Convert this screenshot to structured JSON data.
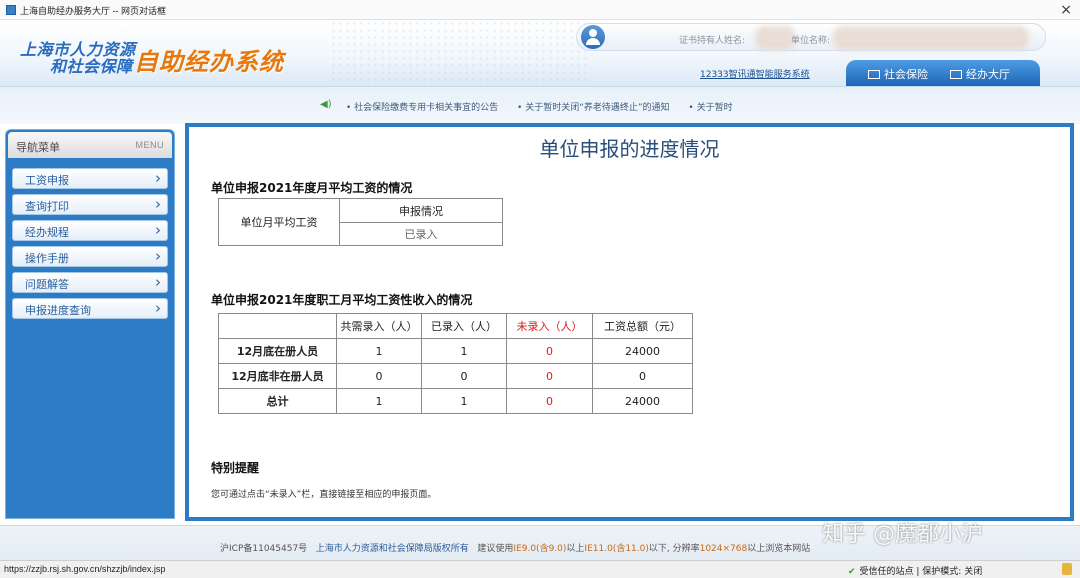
{
  "window": {
    "title": "上海自助经办服务大厅 -- 网页对话框",
    "close_glyph": "×"
  },
  "header": {
    "logo_line1": "上海市人力资源",
    "logo_line2": "和社会保障",
    "logo_system": "自助经办系统",
    "holder_label": "证书持有人姓名:",
    "unit_label": "单位名称:",
    "service_link": "12333智讯通智能服务系统",
    "tabs": [
      {
        "label": "社会保险"
      },
      {
        "label": "经办大厅"
      }
    ]
  },
  "news": {
    "items": [
      "• 社会保险缴费专用卡相关事宜的公告",
      "• 关于暂时关闭“养老待遇终止”的通知",
      "• 关于暂时"
    ]
  },
  "sidebar": {
    "title": "导航菜单",
    "menu_label": "MENU",
    "items": [
      {
        "label": "工资申报"
      },
      {
        "label": "查询打印"
      },
      {
        "label": "经办规程"
      },
      {
        "label": "操作手册"
      },
      {
        "label": "问题解答"
      },
      {
        "label": "申报进度查询"
      }
    ]
  },
  "main": {
    "title": "单位申报的进度情况",
    "section1": {
      "title": "单位申报2021年度月平均工资的情况",
      "row_header": "单位月平均工资",
      "col_header": "申报情况",
      "status": "已录入"
    },
    "section2": {
      "title": "单位申报2021年度职工月平均工资性收入的情况",
      "headers": [
        "",
        "共需录入（人）",
        "已录入（人）",
        "未录入（人）",
        "工资总额（元）"
      ],
      "rows": [
        {
          "label": "12月底在册人员",
          "values": [
            "1",
            "1",
            "0",
            "24000"
          ]
        },
        {
          "label": "12月底非在册人员",
          "values": [
            "0",
            "0",
            "0",
            "0"
          ]
        },
        {
          "label": "总计",
          "values": [
            "1",
            "1",
            "0",
            "24000"
          ]
        }
      ]
    },
    "notice": {
      "title": "特别提醒",
      "text": "您可通过点击“未录入”栏，直接链接至相应的申报页面。"
    }
  },
  "footer": {
    "icp": "沪ICP备11045457号",
    "copyright": "上海市人力资源和社会保障局版权所有",
    "advice_prefix": "建议使用",
    "ie_range": "IE9.0(含9.0)",
    "advice_mid": "以上",
    "ie_upper": "IE11.0(含11.0)",
    "advice_res": "以下, 分辨率",
    "resolution": "1024×768",
    "advice_suffix": "以上浏览本网站"
  },
  "watermark": "知乎 @魔都小沪",
  "status": {
    "url": "https://zzjb.rsj.sh.gov.cn/shzzjb/index.jsp",
    "check_glyph": "✔",
    "zone": "受信任的站点 | 保护模式: 关闭"
  },
  "colors": {
    "accent_blue": "#2c7cc5",
    "logo_orange": "#e9780b",
    "alert_red": "#e21818"
  }
}
